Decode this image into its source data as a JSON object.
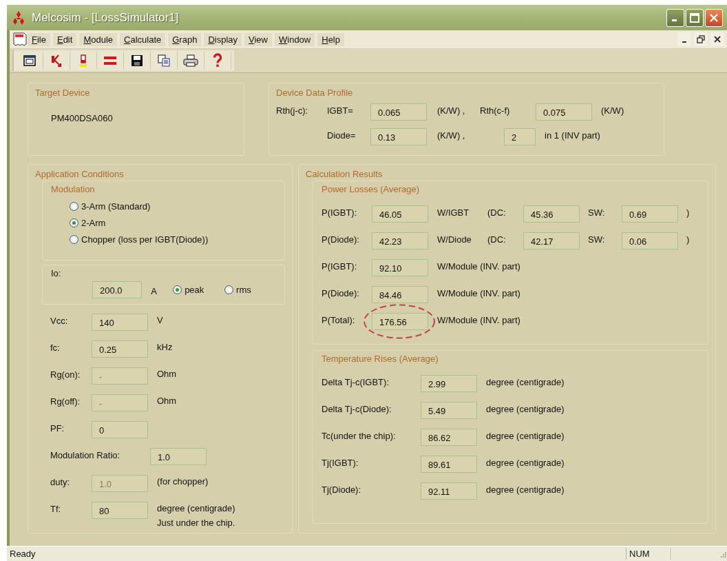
{
  "window": {
    "title": "Melcosim - [LossSimulator1]"
  },
  "menu": [
    "File",
    "Edit",
    "Module",
    "Calculate",
    "Graph",
    "Display",
    "View",
    "Window",
    "Help"
  ],
  "target_device": {
    "title": "Target Device",
    "value": "PM400DSA060"
  },
  "device_data_profile": {
    "title": "Device Data Profile",
    "rth_label": "Rth(j-c):",
    "igbt_label": "IGBT=",
    "igbt_value": "0.065",
    "igbt_unit": "(K/W) ,",
    "rth_cf_label": "Rth(c-f)",
    "rth_cf_value": "0.075",
    "rth_cf_unit": "(K/W)",
    "diode_label": "Diode=",
    "diode_value": "0.13",
    "diode_unit": "(K/W) ,",
    "count_value": "2",
    "count_unit": "in 1 (INV part)"
  },
  "application_conditions": {
    "title": "Application Conditions",
    "modulation": {
      "title": "Modulation",
      "options": [
        {
          "label": "3-Arm (Standard)",
          "selected": false
        },
        {
          "label": "2-Arm",
          "selected": true
        },
        {
          "label": "Chopper (loss per IGBT(Diode))",
          "selected": false
        }
      ]
    },
    "io": {
      "label": "Io:",
      "value": "200.0",
      "unit": "A",
      "options": [
        {
          "label": "peak",
          "selected": true
        },
        {
          "label": "rms",
          "selected": false
        }
      ]
    },
    "params": [
      {
        "kind": "normal",
        "label": "Vcc:",
        "value": "140",
        "unit": "V",
        "disabled": false
      },
      {
        "kind": "normal",
        "label": "fc:",
        "value": "0.25",
        "unit": "kHz",
        "disabled": false
      },
      {
        "kind": "normal",
        "label": "Rg(on):",
        "value": "-",
        "unit": "Ohm",
        "disabled": true
      },
      {
        "kind": "normal",
        "label": "Rg(off):",
        "value": "-",
        "unit": "Ohm",
        "disabled": true
      },
      {
        "kind": "normal",
        "label": "PF:",
        "value": "0",
        "disabled": false
      },
      {
        "kind": "wide",
        "label": "Modulation Ratio:",
        "value": "1.0",
        "disabled": false
      },
      {
        "kind": "normal",
        "label": "duty:",
        "value": "1.0",
        "unit": "(for chopper)",
        "disabled": true
      },
      {
        "kind": "normal",
        "label": "Tf:",
        "value": "80",
        "unit": "degree (centigrade)",
        "note": "Just under the chip.",
        "disabled": false
      }
    ]
  },
  "calculation_results": {
    "title": "Calculation Results",
    "power_losses": {
      "title": "Power Losses (Average)",
      "rows": [
        {
          "label": "P(IGBT):",
          "value": "46.05",
          "unit": "W/IGBT",
          "dc_label": "(DC:",
          "dc_value": "45.36",
          "sw_label": "SW:",
          "sw_value": "0.69",
          "close": ")",
          "highlighted": false
        },
        {
          "label": "P(Diode):",
          "value": "42.23",
          "unit": "W/Diode",
          "dc_label": "(DC:",
          "dc_value": "42.17",
          "sw_label": "SW:",
          "sw_value": "0.06",
          "close": ")",
          "highlighted": false
        },
        {
          "label": "P(IGBT):",
          "value": "92.10",
          "unit": "W/Module (INV. part)",
          "highlighted": false
        },
        {
          "label": "P(Diode):",
          "value": "84.46",
          "unit": "W/Module (INV. part)",
          "highlighted": false
        },
        {
          "label": "P(Total):",
          "value": "176.56",
          "unit": "W/Module (INV. part)",
          "highlighted": true
        }
      ]
    },
    "temperature_rises": {
      "title": "Temperature Rises (Average)",
      "rows": [
        {
          "label": "Delta Tj-c(IGBT):",
          "value": "2.99",
          "unit": "degree (centigrade)"
        },
        {
          "label": "Delta Tj-c(Diode):",
          "value": "5.49",
          "unit": "degree (centigrade)"
        },
        {
          "label": "Tc(under the chip):",
          "value": "86.62",
          "unit": "degree (centigrade)"
        },
        {
          "label": "Tj(IGBT):",
          "value": "89.61",
          "unit": "degree (centigrade)"
        },
        {
          "label": "Tj(Diode):",
          "value": "92.11",
          "unit": "degree (centigrade)"
        }
      ]
    }
  },
  "status_bar": {
    "text": "Ready",
    "indicators": [
      "NUM"
    ]
  }
}
